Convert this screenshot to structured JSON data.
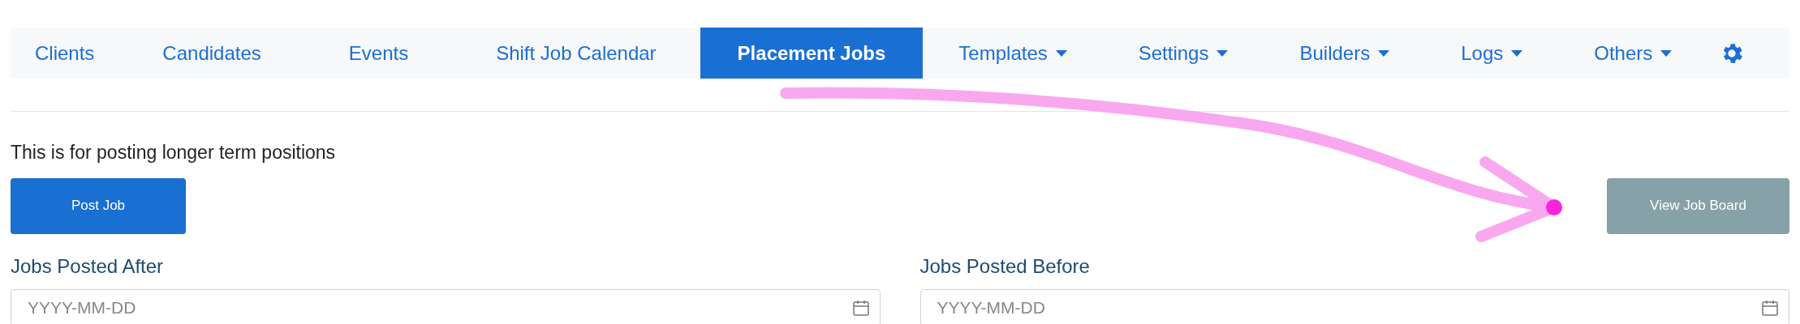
{
  "nav": {
    "items": [
      {
        "label": "Clients",
        "kind": "link",
        "selected": false
      },
      {
        "label": "Candidates",
        "kind": "link",
        "selected": false
      },
      {
        "label": "Events",
        "kind": "link",
        "selected": false
      },
      {
        "label": "Shift Job Calendar",
        "kind": "link",
        "selected": false
      },
      {
        "label": "Placement Jobs",
        "kind": "link",
        "selected": true
      },
      {
        "label": "Templates",
        "kind": "dropdown",
        "selected": false
      },
      {
        "label": "Settings",
        "kind": "dropdown",
        "selected": false
      },
      {
        "label": "Builders",
        "kind": "dropdown",
        "selected": false
      },
      {
        "label": "Logs",
        "kind": "dropdown",
        "selected": false
      },
      {
        "label": "Others",
        "kind": "dropdown",
        "selected": false
      },
      {
        "kind": "settings",
        "selected": false
      }
    ]
  },
  "intro": "This is for posting longer term positions",
  "buttons": {
    "post": "Post Job",
    "view_board": "View Job Board"
  },
  "filters": [
    {
      "label": "Jobs Posted After",
      "placeholder": "YYYY-MM-DD"
    },
    {
      "label": "Jobs Posted Before",
      "placeholder": "YYYY-MM-DD"
    }
  ]
}
